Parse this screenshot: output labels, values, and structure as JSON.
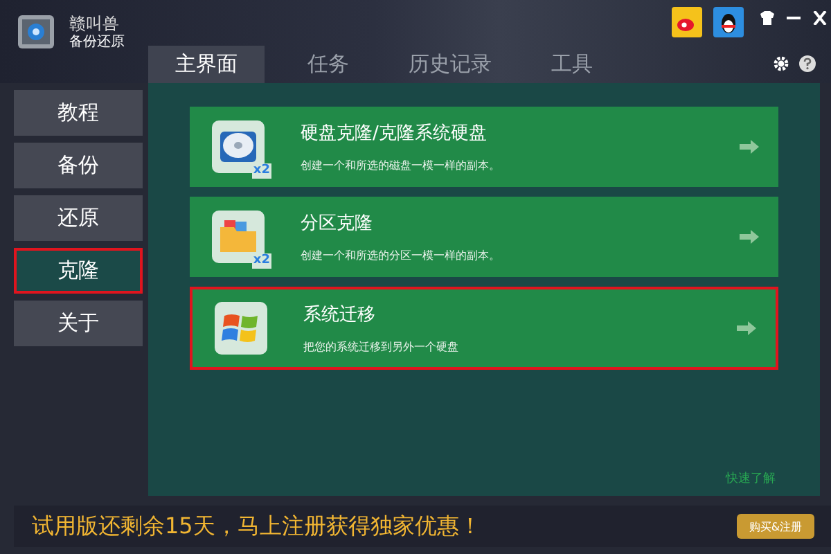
{
  "app": {
    "logo_text": "赣叫兽",
    "subtitle": "备份还原"
  },
  "tabs": [
    {
      "label": "主界面",
      "selected": true
    },
    {
      "label": "任务",
      "selected": false
    },
    {
      "label": "历史记录",
      "selected": false
    },
    {
      "label": "工具",
      "selected": false
    }
  ],
  "sidebar": {
    "items": [
      {
        "label": "教程",
        "selected": false,
        "highlighted": false
      },
      {
        "label": "备份",
        "selected": false,
        "highlighted": false
      },
      {
        "label": "还原",
        "selected": false,
        "highlighted": false
      },
      {
        "label": "克隆",
        "selected": true,
        "highlighted": true
      },
      {
        "label": "关于",
        "selected": false,
        "highlighted": false
      }
    ]
  },
  "cards": [
    {
      "kind": "disk",
      "title": "硬盘克隆/克隆系统硬盘",
      "description": "创建一个和所选的磁盘一模一样的副本。",
      "badge": "x2",
      "highlighted": false
    },
    {
      "kind": "folder",
      "title": "分区克隆",
      "description": "创建一个和所选的分区一模一样的副本。",
      "badge": "x2",
      "highlighted": false
    },
    {
      "kind": "windows",
      "title": "系统迁移",
      "description": "把您的系统迁移到另外一个硬盘",
      "highlighted": true
    }
  ],
  "quick_link": "快速了解",
  "status_bar": {
    "message": "试用版还剩余15天，马上注册获得独家优惠！",
    "button": "购买&注册"
  }
}
